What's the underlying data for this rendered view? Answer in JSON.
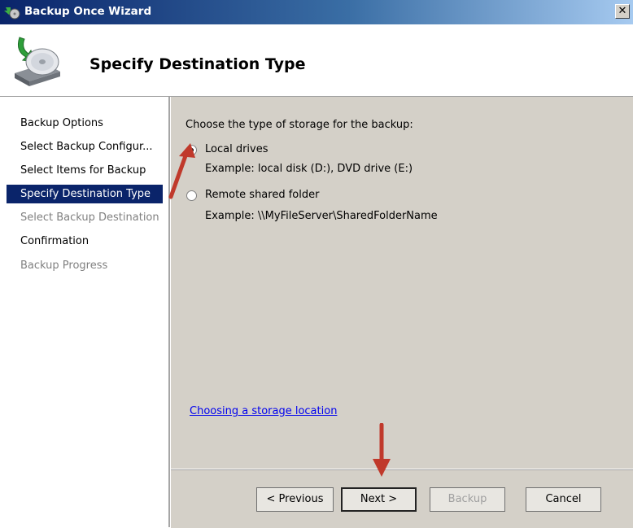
{
  "window": {
    "title": "Backup Once Wizard",
    "close_glyph": "✕"
  },
  "header": {
    "title": "Specify Destination Type"
  },
  "nav": {
    "items": [
      {
        "label": "Backup Options",
        "state": "normal"
      },
      {
        "label": "Select Backup Configur...",
        "state": "normal"
      },
      {
        "label": "Select Items for Backup",
        "state": "normal"
      },
      {
        "label": "Specify Destination Type",
        "state": "active"
      },
      {
        "label": "Select Backup Destination",
        "state": "disabled"
      },
      {
        "label": "Confirmation",
        "state": "normal"
      },
      {
        "label": "Backup Progress",
        "state": "disabled"
      }
    ]
  },
  "content": {
    "prompt": "Choose the type of storage for the backup:",
    "options": [
      {
        "label": "Local drives",
        "example": "Example: local disk (D:), DVD drive (E:)",
        "checked": true
      },
      {
        "label": "Remote shared folder",
        "example": "Example: \\\\MyFileServer\\SharedFolderName",
        "checked": false
      }
    ],
    "link": "Choosing a storage location"
  },
  "buttons": {
    "previous": "< Previous",
    "next": "Next >",
    "backup": "Backup",
    "cancel": "Cancel"
  },
  "colors": {
    "annotation_arrow": "#c0392b",
    "selection": "#0a246a"
  }
}
